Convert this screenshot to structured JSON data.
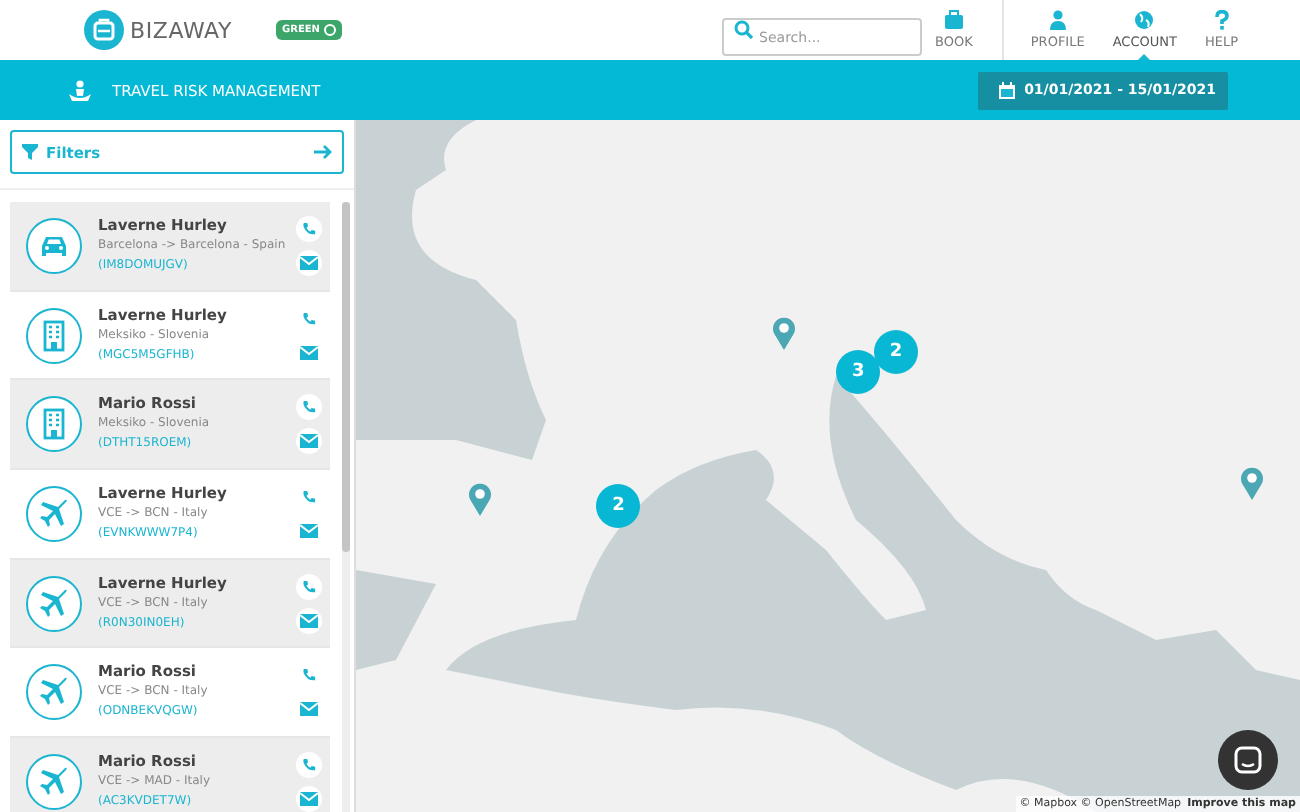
{
  "header": {
    "logo": "BIZAWAY",
    "badge": "GREEN",
    "search": {
      "placeholder": "Search..."
    },
    "nav": [
      {
        "label": "BOOK",
        "selected": false
      },
      {
        "label": "PROFILE",
        "selected": false
      },
      {
        "label": "ACCOUNT",
        "selected": true
      },
      {
        "label": "HELP",
        "selected": false
      }
    ]
  },
  "toolbar": {
    "title": "TRAVEL RISK MANAGEMENT",
    "date_range": "01/01/2021 - 15/01/2021"
  },
  "filters": {
    "label": "Filters"
  },
  "travellers": [
    {
      "kind": "car",
      "name": "Laverne Hurley",
      "route": "Barcelona -> Barcelona - Spain",
      "code": "(IM8DOMUJGV)"
    },
    {
      "kind": "hotel",
      "name": "Laverne Hurley",
      "route": "Meksiko - Slovenia",
      "code": "(MGC5M5GFHB)"
    },
    {
      "kind": "hotel",
      "name": "Mario Rossi",
      "route": "Meksiko - Slovenia",
      "code": "(DTHT15ROEM)"
    },
    {
      "kind": "flight",
      "name": "Laverne Hurley",
      "route": "VCE -> BCN - Italy",
      "code": "(EVNKWWW7P4)"
    },
    {
      "kind": "flight",
      "name": "Laverne Hurley",
      "route": "VCE -> BCN - Italy",
      "code": "(R0N30IN0EH)"
    },
    {
      "kind": "flight",
      "name": "Mario Rossi",
      "route": "VCE -> BCN - Italy",
      "code": "(ODNBEKVQGW)"
    },
    {
      "kind": "flight",
      "name": "Mario Rossi",
      "route": "VCE -> MAD - Italy",
      "code": "(AC3KVDET7W)"
    }
  ],
  "map": {
    "markers": [
      {
        "kind": "pin"
      },
      {
        "kind": "cluster",
        "count": "3"
      },
      {
        "kind": "cluster",
        "count": "2"
      },
      {
        "kind": "cluster",
        "count": "2"
      },
      {
        "kind": "pin"
      },
      {
        "kind": "pin"
      }
    ],
    "attribution": "© Mapbox © OpenStreetMap",
    "improve_link": "Improve this map"
  }
}
